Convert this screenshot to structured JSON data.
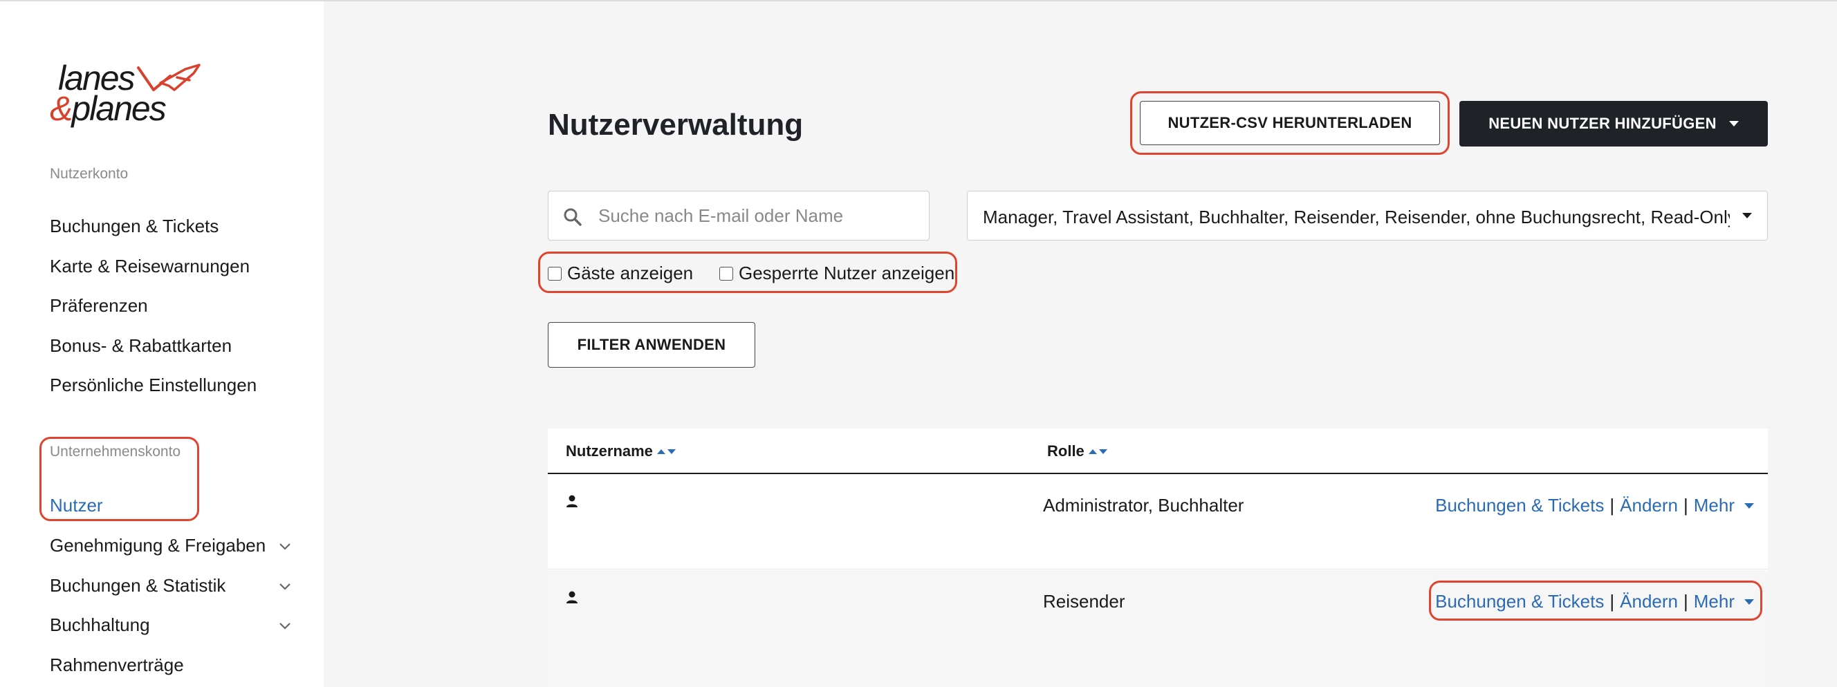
{
  "logo": {
    "line1": "lanes",
    "amp": "&",
    "line2": "planes"
  },
  "sidebar": {
    "section1_label": "Nutzerkonto",
    "section1_items": [
      {
        "label": "Buchungen & Tickets"
      },
      {
        "label": "Karte & Reisewarnungen"
      },
      {
        "label": "Präferenzen"
      },
      {
        "label": "Bonus- & Rabattkarten"
      },
      {
        "label": "Persönliche Einstellungen"
      }
    ],
    "section2_label": "Unternehmenskonto",
    "section2_items": [
      {
        "label": "Nutzer",
        "active": true
      },
      {
        "label": "Genehmigung & Freigaben",
        "expandable": true
      },
      {
        "label": "Buchungen & Statistik",
        "expandable": true
      },
      {
        "label": "Buchhaltung",
        "expandable": true
      },
      {
        "label": "Rahmenverträge"
      }
    ]
  },
  "main": {
    "title": "Nutzerverwaltung",
    "download_csv_label": "NUTZER-CSV HERUNTERLADEN",
    "add_user_label": "NEUEN NUTZER HINZUFÜGEN",
    "search_placeholder": "Suche nach E-mail oder Name",
    "role_filter_value": "Manager, Travel Assistant, Buchhalter, Reisender, Reisender, ohne Buchungsrecht, Read-Only A",
    "show_guests_label": "Gäste anzeigen",
    "show_blocked_label": "Gesperrte Nutzer anzeigen",
    "apply_filter_label": "FILTER ANWENDEN"
  },
  "table": {
    "columns": [
      "Nutzername",
      "Rolle"
    ],
    "rows": [
      {
        "username": "",
        "role": "Administrator, Buchhalter",
        "action_bookings": "Buchungen & Tickets",
        "action_edit": "Ändern",
        "action_more": "Mehr"
      },
      {
        "username": "",
        "role": "Reisender",
        "action_bookings": "Buchungen & Tickets",
        "action_edit": "Ändern",
        "action_more": "Mehr"
      }
    ],
    "separator": "|"
  },
  "colors": {
    "accent_blue": "#2a6bb3",
    "dark_button": "#1f2328",
    "highlight_red": "#e0442f",
    "logo_red": "#d9412c"
  }
}
